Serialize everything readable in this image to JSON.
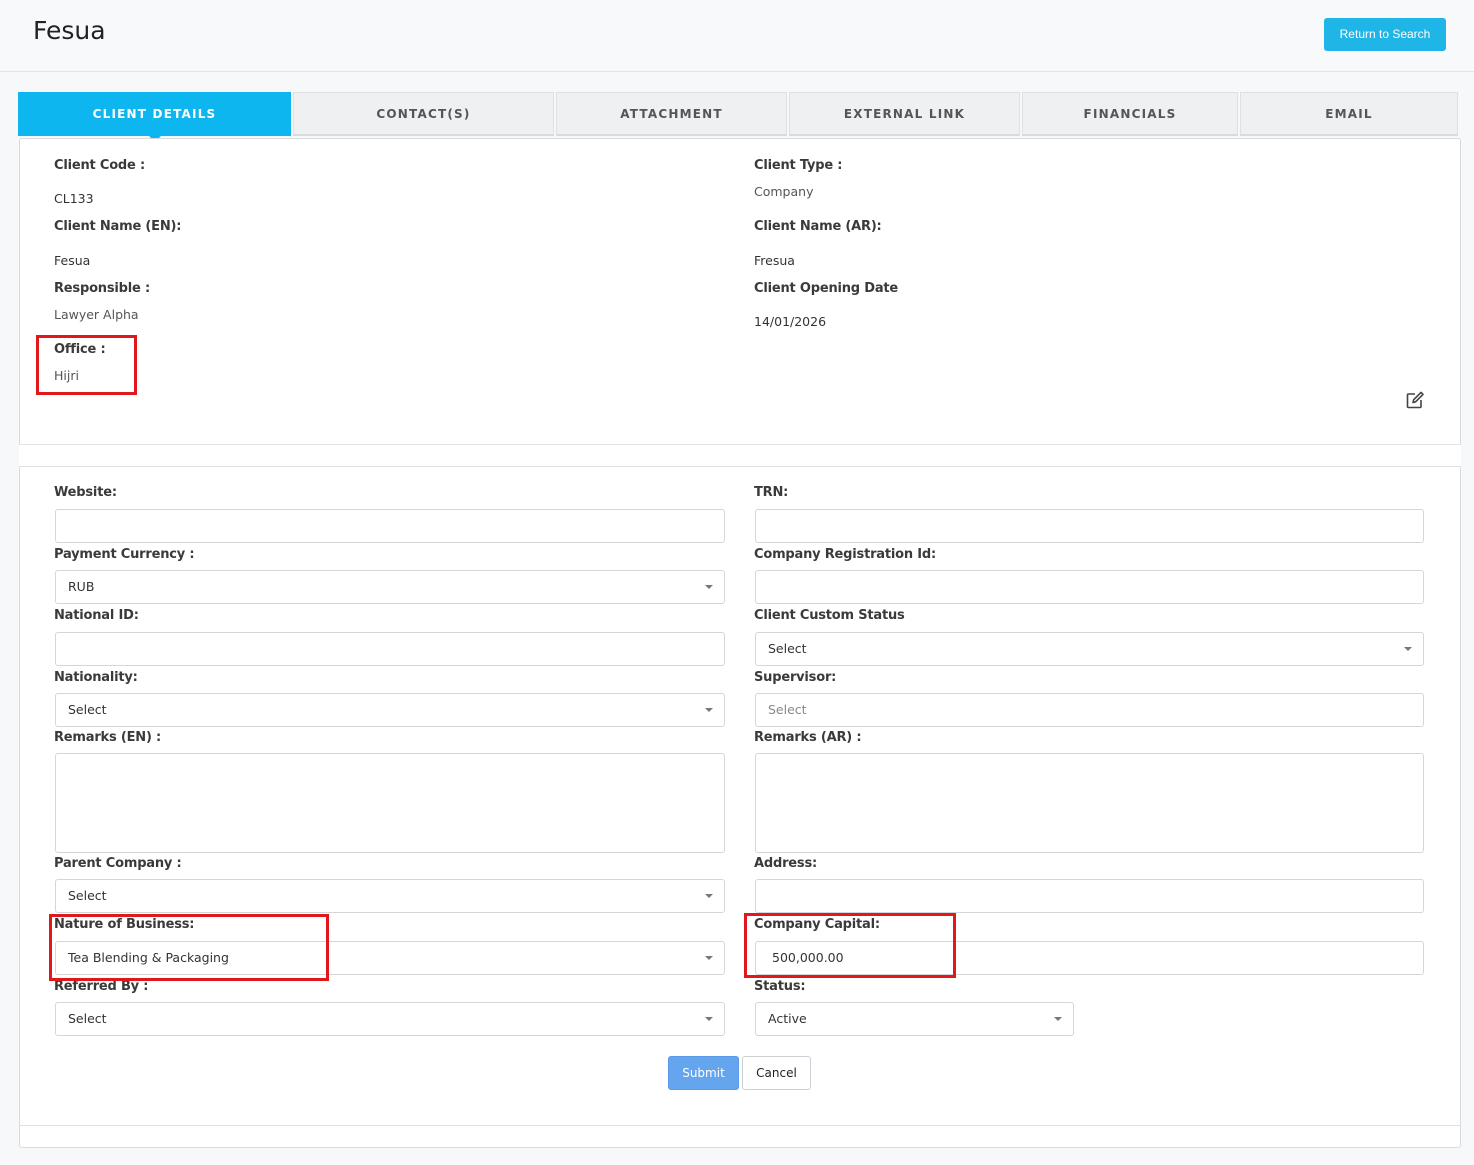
{
  "header": {
    "title": "Fesua",
    "return_button": "Return to Search"
  },
  "tabs": [
    {
      "label": "CLIENT DETAILS",
      "active": true
    },
    {
      "label": "CONTACT(S)"
    },
    {
      "label": "ATTACHMENT"
    },
    {
      "label": "EXTERNAL LINK"
    },
    {
      "label": "FINANCIALS"
    },
    {
      "label": "EMAIL"
    }
  ],
  "details": {
    "client_code_label": "Client Code :",
    "client_code": "CL133",
    "client_type_label": "Client Type :",
    "client_type": "Company",
    "client_name_en_label": "Client Name (EN):",
    "client_name_en": "Fesua",
    "client_name_ar_label": "Client Name (AR):",
    "client_name_ar": "Fresua",
    "responsible_label": "Responsible :",
    "responsible": "Lawyer Alpha",
    "opening_date_label": "Client Opening Date",
    "opening_date": "14/01/2026",
    "office_label": "Office :",
    "office": "Hijri"
  },
  "form": {
    "website_label": "Website:",
    "website": "",
    "trn_label": "TRN:",
    "trn": "",
    "payment_currency_label": "Payment Currency :",
    "payment_currency": "RUB",
    "company_reg_label": "Company Registration Id:",
    "company_reg": "",
    "national_id_label": "National ID:",
    "national_id": "",
    "custom_status_label": "Client Custom Status",
    "custom_status": "Select",
    "nationality_label": "Nationality:",
    "nationality": "Select",
    "supervisor_label": "Supervisor:",
    "supervisor_placeholder": "Select",
    "remarks_en_label": "Remarks (EN) :",
    "remarks_ar_label": "Remarks (AR) :",
    "parent_company_label": "Parent Company :",
    "parent_company": "Select",
    "address_label": "Address:",
    "address": "",
    "nature_label": "Nature of Business:",
    "nature": "Tea Blending & Packaging",
    "capital_label": "Company Capital:",
    "capital": "500,000.00",
    "referred_label": "Referred By :",
    "referred": "Select",
    "status_label": "Status:",
    "status": "Active",
    "submit": "Submit",
    "cancel": "Cancel"
  },
  "colors": {
    "accent": "#0eb6f0",
    "return_button": "#1fb5e7",
    "submit_button": "#64a5ee",
    "highlight": "#e0171b"
  }
}
